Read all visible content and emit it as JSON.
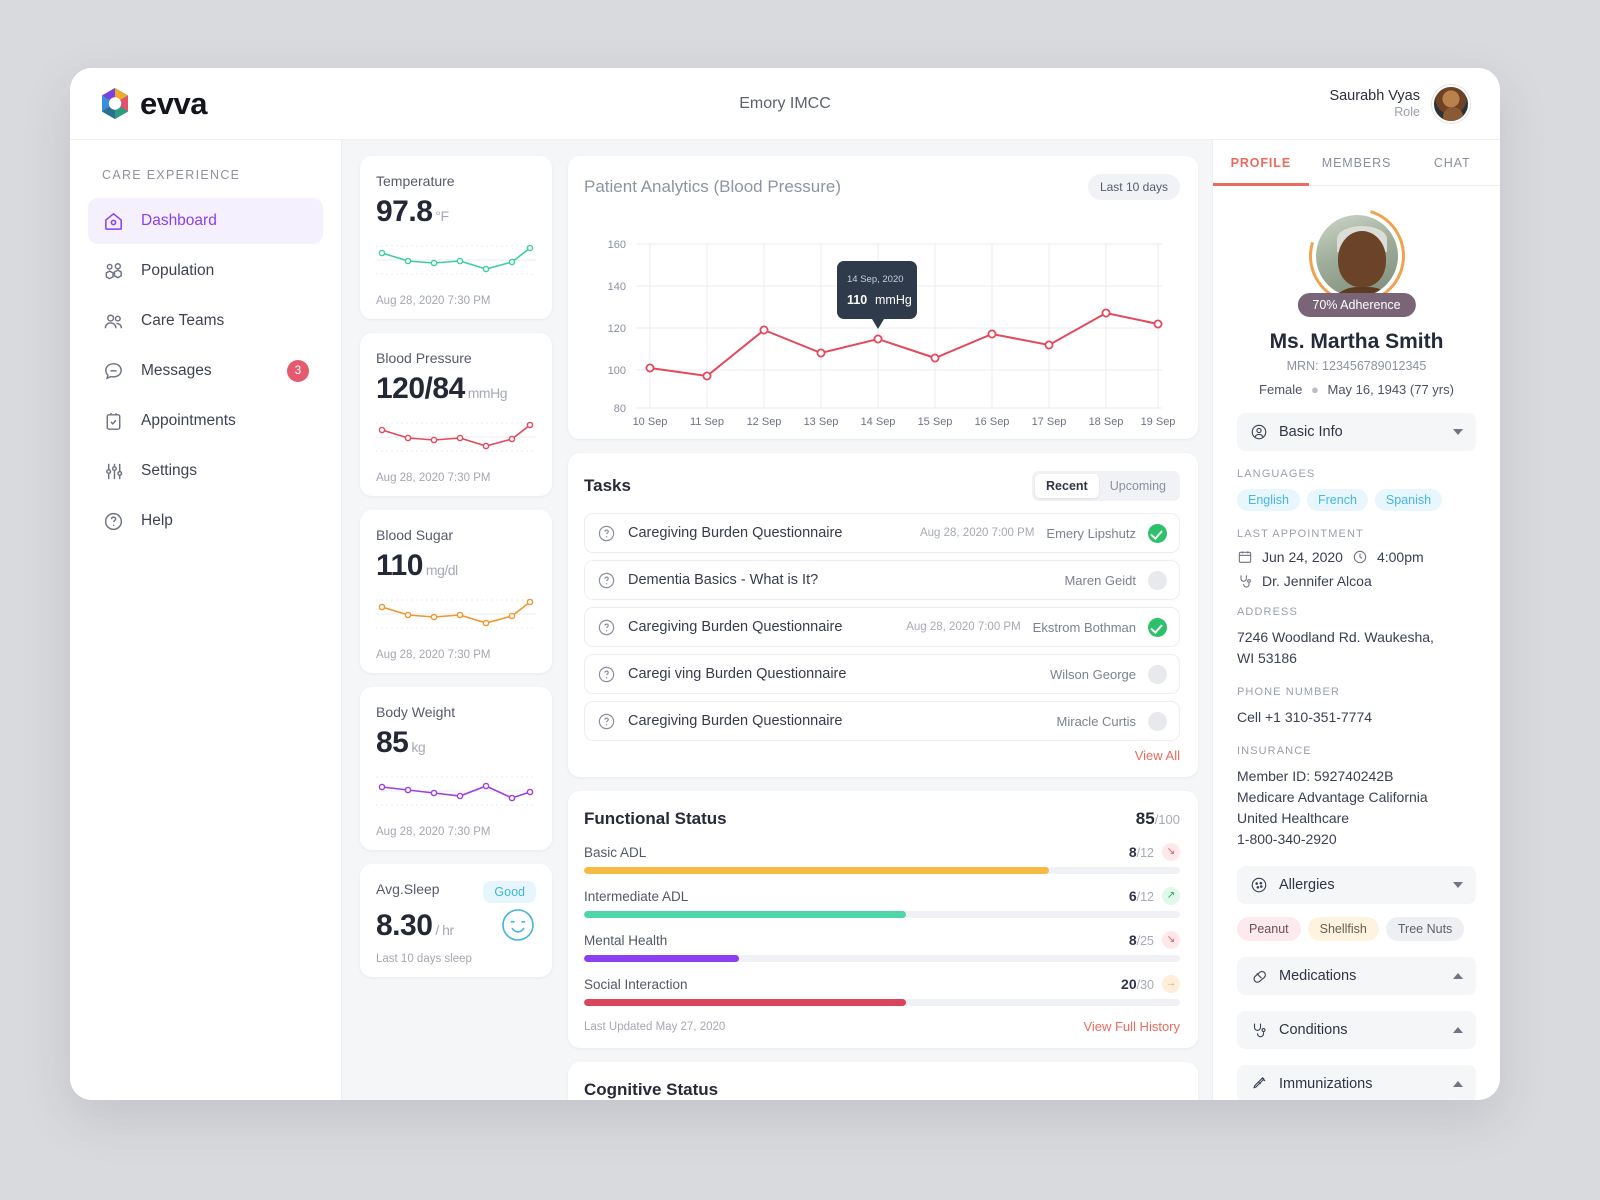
{
  "header": {
    "logo_text": "evva",
    "title": "Emory IMCC",
    "user_name": "Saurabh Vyas",
    "user_role": "Role"
  },
  "sidebar": {
    "section_title": "CARE EXPERIENCE",
    "items": [
      {
        "label": "Dashboard",
        "icon": "home-icon",
        "active": true
      },
      {
        "label": "Population",
        "icon": "population-icon",
        "active": false
      },
      {
        "label": "Care Teams",
        "icon": "care-teams-icon",
        "active": false
      },
      {
        "label": "Messages",
        "icon": "message-icon",
        "active": false,
        "badge": "3"
      },
      {
        "label": "Appointments",
        "icon": "clipboard-icon",
        "active": false
      },
      {
        "label": "Settings",
        "icon": "sliders-icon",
        "active": false
      },
      {
        "label": "Help",
        "icon": "question-icon",
        "active": false
      }
    ]
  },
  "vitals": [
    {
      "label": "Temperature",
      "value": "97.8",
      "unit": "°F",
      "date": "Aug 28, 2020 7:30 PM",
      "color": "#3ecfa0",
      "points": [
        62,
        40,
        36,
        38,
        20,
        32,
        72
      ]
    },
    {
      "label": "Blood Pressure",
      "value": "120/84",
      "unit": "mmHg",
      "date": "Aug 28, 2020 7:30 PM",
      "color": "#e4485c",
      "points": [
        62,
        40,
        36,
        38,
        20,
        32,
        72
      ]
    },
    {
      "label": "Blood Sugar",
      "value": "110",
      "unit": "mg/dl",
      "date": "Aug 28, 2020 7:30 PM",
      "color": "#f0962f",
      "points": [
        62,
        40,
        36,
        38,
        20,
        32,
        72
      ]
    },
    {
      "label": "Body Weight",
      "value": "85",
      "unit": "kg",
      "date": "Aug 28, 2020 7:30 PM",
      "color": "#9b3fe0",
      "points": [
        62,
        48,
        42,
        32,
        60,
        24,
        42
      ]
    }
  ],
  "sleep": {
    "label": "Avg.Sleep",
    "status": "Good",
    "value": "8.30",
    "unit": "/ hr",
    "sub": "Last 10 days sleep"
  },
  "chart_data": {
    "type": "line",
    "title": "Patient Analytics",
    "subtitle": "(Blood Pressure)",
    "range_chip": "Last 10 days",
    "xlabel": "",
    "ylabel": "",
    "series_color": "#e4485c",
    "categories": [
      "10 Sep",
      "11 Sep",
      "12 Sep",
      "13 Sep",
      "14 Sep",
      "15 Sep",
      "16 Sep",
      "17 Sep",
      "18 Sep",
      "19 Sep"
    ],
    "values": [
      99,
      95,
      117,
      106,
      113,
      104,
      115,
      110,
      125,
      120
    ],
    "yticks": [
      160,
      140,
      120,
      100,
      80
    ],
    "ylim": [
      70,
      168
    ],
    "grid": true,
    "tooltip": {
      "index": 4,
      "date": "14 Sep, 2020",
      "value": "110",
      "unit": "mmHg"
    }
  },
  "tasks": {
    "title": "Tasks",
    "tabs": [
      {
        "label": "Recent",
        "active": true
      },
      {
        "label": "Upcoming",
        "active": false
      }
    ],
    "view_all": "View All",
    "rows": [
      {
        "name": "Caregiving Burden Questionnaire",
        "date": "Aug 28, 2020 7:00 PM",
        "owner": "Emery Lipshutz",
        "done": true
      },
      {
        "name": "Dementia Basics - What is It?",
        "date": "",
        "owner": "Maren Geidt",
        "done": false
      },
      {
        "name": "Caregiving Burden Questionnaire",
        "date": "Aug 28, 2020 7:00 PM",
        "owner": "Ekstrom Bothman",
        "done": true
      },
      {
        "name": "Caregi ving Burden Questionnaire",
        "date": "",
        "owner": "Wilson George",
        "done": false
      },
      {
        "name": "Caregiving Burden Questionnaire",
        "date": "",
        "owner": "Miracle Curtis",
        "done": false
      }
    ]
  },
  "functional": {
    "title": "Functional Status",
    "score": "85",
    "score_max": "/100",
    "updated": "Last Updated May 27, 2020",
    "history_link": "View Full History",
    "rows": [
      {
        "label": "Basic ADL",
        "value": "8",
        "max": "/12",
        "percent": 78,
        "color": "#f5bb43",
        "trend": "down",
        "arrow": "↘"
      },
      {
        "label": "Intermediate ADL",
        "value": "6",
        "max": "/12",
        "percent": 54,
        "color": "#4fd6a8",
        "trend": "up",
        "arrow": "↗"
      },
      {
        "label": "Mental Health",
        "value": "8",
        "max": "/25",
        "percent": 26,
        "color": "#8b3ff0",
        "trend": "down",
        "arrow": "↘"
      },
      {
        "label": "Social Interaction",
        "value": "20",
        "max": "/30",
        "percent": 54,
        "color": "#d9455a",
        "trend": "flat",
        "arrow": "→"
      }
    ]
  },
  "cognitive": {
    "title": "Cognitive Status"
  },
  "right_panel": {
    "tabs": [
      {
        "label": "PROFILE",
        "active": true
      },
      {
        "label": "MEMBERS",
        "active": false
      },
      {
        "label": "CHAT",
        "active": false
      }
    ],
    "adherence": "70% Adherence",
    "patient_name": "Ms. Martha Smith",
    "mrn": "MRN: 123456789012345",
    "sex": "Female",
    "dob": "May 16, 1943 (77 yrs)",
    "basic_info_label": "Basic Info",
    "languages_label": "LANGUAGES",
    "languages": [
      "English",
      "French",
      "Spanish"
    ],
    "last_appointment_label": "LAST APPOINTMENT",
    "appointment_date": "Jun 24, 2020",
    "appointment_time": "4:00pm",
    "appointment_doctor": "Dr. Jennifer Alcoa",
    "address_label": "ADDRESS",
    "address_line1": "7246 Woodland Rd. Waukesha,",
    "address_line2": "WI 53186",
    "phone_label": "PHONE NUMBER",
    "phone": "Cell +1 310-351-7774",
    "insurance_label": "INSURANCE",
    "insurance_lines": [
      "Member ID: 592740242B",
      "Medicare Advantage California",
      "United Healthcare",
      "1-800-340-2920"
    ],
    "allergies_label": "Allergies",
    "allergies": [
      "Peanut",
      "Shellfish",
      "Tree Nuts"
    ],
    "medications_label": "Medications",
    "conditions_label": "Conditions",
    "immunizations_label": "Immunizations"
  }
}
